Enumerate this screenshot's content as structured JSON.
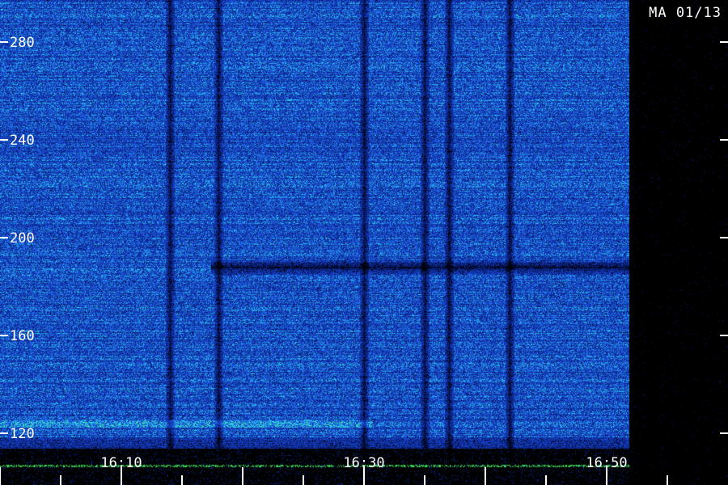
{
  "header": {
    "station_label": "MA 01/13"
  },
  "colors": {
    "background": "#000000",
    "low": "#061a6e",
    "mid": "#1d4de0",
    "high": "#2ad6f0",
    "peak": "#55ff66",
    "ticks": "#ffffff"
  },
  "chart_data": {
    "type": "heatmap",
    "title": "",
    "xlabel": "",
    "ylabel": "",
    "x_ticks": [
      "16:10",
      "16:30",
      "16:50"
    ],
    "y_ticks": [
      280,
      240,
      200,
      160,
      120
    ],
    "ylim": [
      110,
      290
    ],
    "xlim": [
      "16:00",
      "16:50"
    ],
    "grid": false,
    "legend": "none",
    "features": {
      "dark_vertical_bands_time": [
        "16:14",
        "16:18",
        "16:30",
        "16:35",
        "16:37",
        "16:42"
      ],
      "dark_horizontal_band_value": 188,
      "bright_horizontal_band_value": 124
    }
  }
}
